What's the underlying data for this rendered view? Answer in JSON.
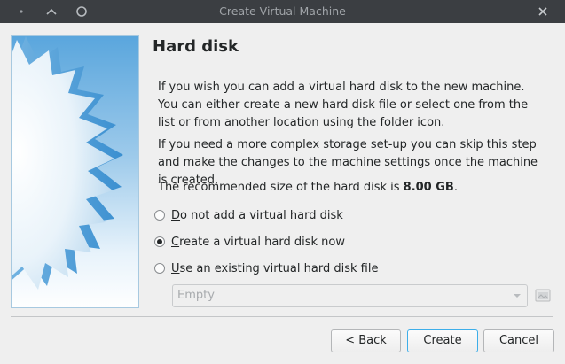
{
  "window": {
    "title": "Create Virtual Machine",
    "controls": [
      "menu-dot-icon",
      "maximize-chevron-icon",
      "minimize-circle-icon",
      "close-x-icon"
    ]
  },
  "page": {
    "title": "Hard disk",
    "paragraph1": "If you wish you can add a virtual hard disk to the new machine. You can either create a new hard disk file or select one from the list or from another location using the folder icon.",
    "paragraph2": "If you need a more complex storage set-up you can skip this step and make the changes to the machine settings once the machine is created.",
    "recommended_prefix": "The recommended size of the hard disk is ",
    "recommended_size": "8.00 GB",
    "recommended_suffix": "."
  },
  "options": [
    {
      "mnemonic": "D",
      "rest": "o not add a virtual hard disk",
      "checked": false
    },
    {
      "mnemonic": "C",
      "rest": "reate a virtual hard disk now",
      "checked": true
    },
    {
      "mnemonic": "U",
      "rest": "se an existing virtual hard disk file",
      "checked": false
    }
  ],
  "disk_select": {
    "value": "Empty",
    "enabled": false
  },
  "buttons": {
    "back_prefix": "< ",
    "back_mnemonic": "B",
    "back_rest": "ack",
    "create": "Create",
    "cancel": "Cancel"
  },
  "colors": {
    "titlebar": "#3b3e42",
    "accent": "#3daee9",
    "window_bg": "#efefef"
  }
}
